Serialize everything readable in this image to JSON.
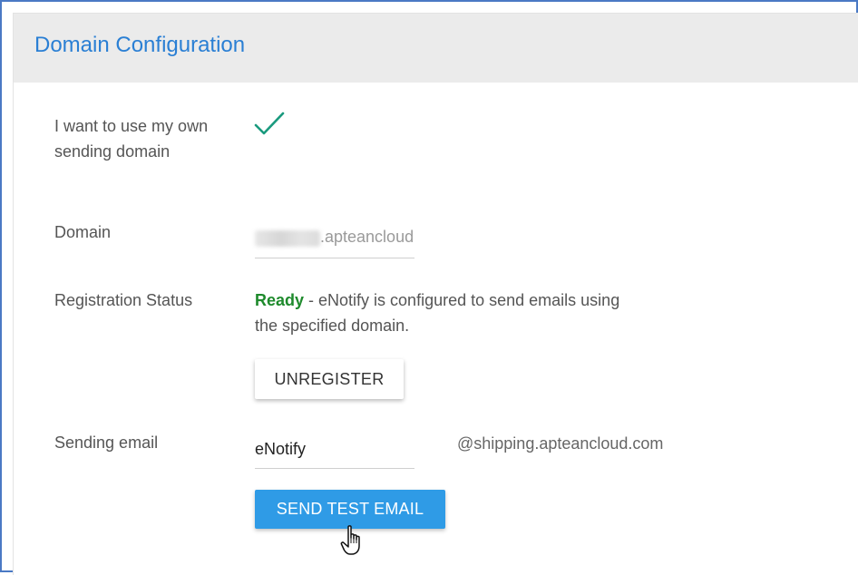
{
  "panel": {
    "title": "Domain Configuration"
  },
  "form": {
    "own_domain": {
      "label": "I want to use my own sending domain",
      "checked": true
    },
    "domain": {
      "label": "Domain",
      "visible_suffix": ".apteancloud"
    },
    "registration_status": {
      "label": "Registration Status",
      "status": "Ready",
      "message": " - eNotify is configured to send emails using the specified domain.",
      "unregister_label": "UNREGISTER"
    },
    "sending_email": {
      "label": "Sending email",
      "value": "eNotify",
      "domain_suffix": "@shipping.apteancloud.com",
      "send_test_label": "SEND TEST EMAIL"
    }
  },
  "colors": {
    "title": "#2a7fd4",
    "check": "#1a9a7e",
    "ready": "#1e8a2c",
    "primary_button": "#2f9be6",
    "frame_border": "#4a79c4"
  },
  "icons": {
    "checkbox": "check-icon",
    "cursor": "hand-pointer-icon"
  }
}
